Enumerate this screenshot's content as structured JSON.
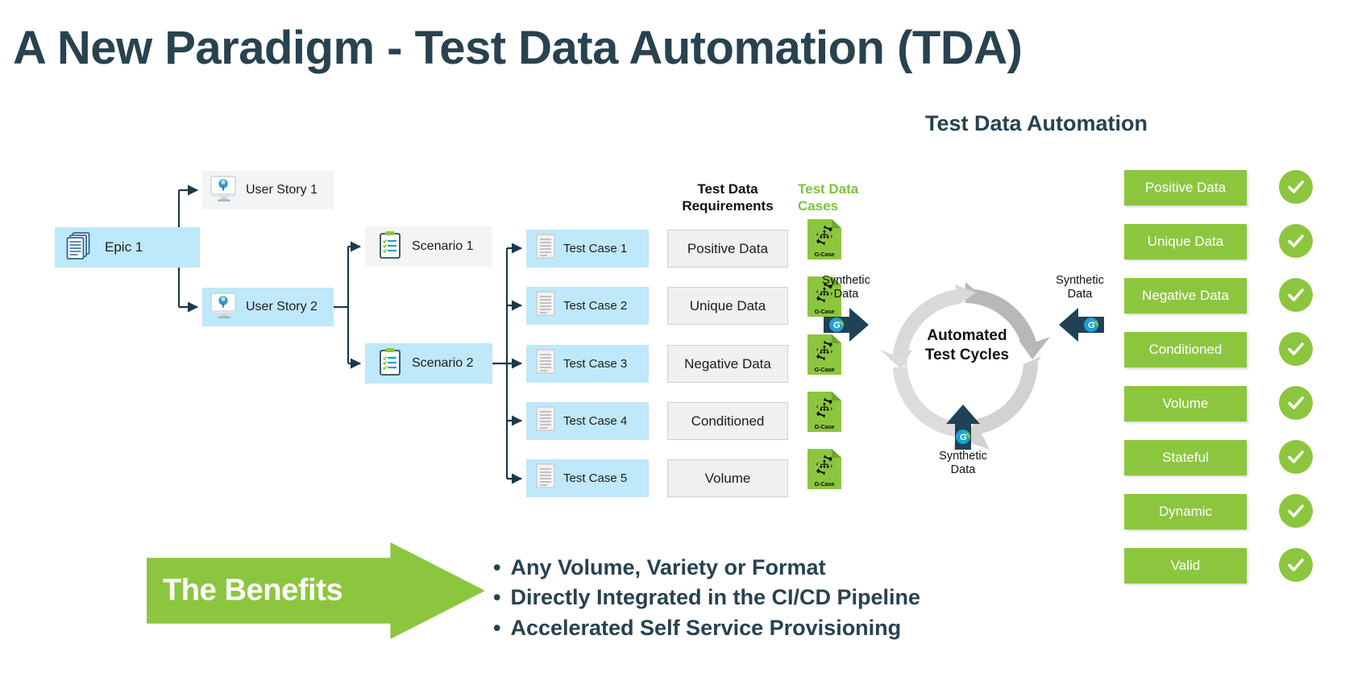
{
  "title": "A New Paradigm - Test Data Automation (TDA)",
  "section_heading": "Test Data Automation",
  "columns": {
    "test_data_requirements": "Test Data\nRequirements",
    "test_data_requirements_line1": "Test Data",
    "test_data_requirements_line2": "Requirements",
    "test_data_cases_line1": "Test Data",
    "test_data_cases_line2": "Cases"
  },
  "flow": {
    "epic": {
      "label": "Epic 1",
      "icon": "documents-stack-icon"
    },
    "user_stories": [
      {
        "label": "User Story 1",
        "icon": "user-monitor-icon",
        "style": "grey"
      },
      {
        "label": "User Story 2",
        "icon": "user-monitor-icon",
        "style": "blue"
      }
    ],
    "scenarios": [
      {
        "label": "Scenario 1",
        "icon": "clipboard-checklist-icon",
        "style": "grey"
      },
      {
        "label": "Scenario 2",
        "icon": "clipboard-checklist-icon",
        "style": "blue"
      }
    ],
    "test_cases": [
      {
        "label": "Test Case 1",
        "icon": "document-icon"
      },
      {
        "label": "Test Case 2",
        "icon": "document-icon"
      },
      {
        "label": "Test Case 3",
        "icon": "document-icon"
      },
      {
        "label": "Test Case 4",
        "icon": "document-icon"
      },
      {
        "label": "Test Case 5",
        "icon": "document-icon"
      }
    ],
    "requirements": [
      "Positive Data",
      "Unique Data",
      "Negative Data",
      "Conditioned",
      "Volume"
    ],
    "gcase_label": "G-Case"
  },
  "cycle": {
    "center_line1": "Automated",
    "center_line2": "Test Cycles",
    "inputs": [
      {
        "label_line1": "Synthetic",
        "label_line2": "Data",
        "position": "left"
      },
      {
        "label_line1": "Synthetic",
        "label_line2": "Data",
        "position": "right"
      },
      {
        "label_line1": "Synthetic",
        "label_line2": "Data",
        "position": "bottom"
      }
    ]
  },
  "outputs": [
    {
      "label": "Positive Data",
      "checked": true
    },
    {
      "label": "Unique Data",
      "checked": true
    },
    {
      "label": "Negative Data",
      "checked": true
    },
    {
      "label": "Conditioned",
      "checked": true
    },
    {
      "label": "Volume",
      "checked": true
    },
    {
      "label": "Stateful",
      "checked": true
    },
    {
      "label": "Dynamic",
      "checked": true
    },
    {
      "label": "Valid",
      "checked": true
    }
  ],
  "benefits": {
    "arrow_label": "The Benefits",
    "items": [
      "Any Volume, Variety or Format",
      "Directly Integrated in the CI/CD Pipeline",
      "Accelerated Self Service Provisioning"
    ]
  },
  "colors": {
    "navy": "#28424f",
    "green": "#8cc63f",
    "light_blue": "#bfe8fa",
    "light_grey": "#f4f4f4",
    "req_grey": "#f0f0f0",
    "arrow_grey": "#d4d4d4",
    "dark_arrow": "#1f4257"
  }
}
